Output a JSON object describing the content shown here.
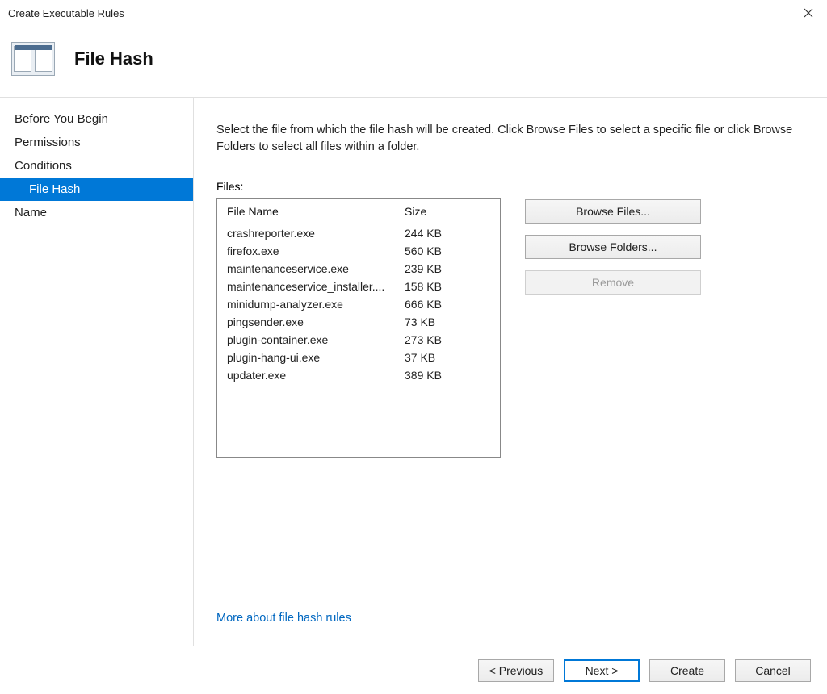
{
  "window": {
    "title": "Create Executable Rules"
  },
  "header": {
    "title": "File Hash"
  },
  "sidebar": {
    "items": [
      {
        "label": "Before You Begin",
        "selected": false,
        "sub": false
      },
      {
        "label": "Permissions",
        "selected": false,
        "sub": false
      },
      {
        "label": "Conditions",
        "selected": false,
        "sub": false
      },
      {
        "label": "File Hash",
        "selected": true,
        "sub": true
      },
      {
        "label": "Name",
        "selected": false,
        "sub": false
      }
    ]
  },
  "main": {
    "instructions": "Select the file from which the file hash will be created. Click Browse Files to select a specific file or click Browse Folders to select all files within a folder.",
    "files_label": "Files:",
    "columns": {
      "name": "File Name",
      "size": "Size"
    },
    "files": [
      {
        "name": "crashreporter.exe",
        "size": "244 KB"
      },
      {
        "name": "firefox.exe",
        "size": "560 KB"
      },
      {
        "name": "maintenanceservice.exe",
        "size": "239 KB"
      },
      {
        "name": "maintenanceservice_installer....",
        "size": "158 KB"
      },
      {
        "name": "minidump-analyzer.exe",
        "size": "666 KB"
      },
      {
        "name": "pingsender.exe",
        "size": "73 KB"
      },
      {
        "name": "plugin-container.exe",
        "size": "273 KB"
      },
      {
        "name": "plugin-hang-ui.exe",
        "size": "37 KB"
      },
      {
        "name": "updater.exe",
        "size": "389 KB"
      }
    ],
    "buttons": {
      "browse_files": "Browse Files...",
      "browse_folders": "Browse Folders...",
      "remove": "Remove"
    },
    "more_link": "More about file hash rules"
  },
  "footer": {
    "previous": "< Previous",
    "next": "Next >",
    "create": "Create",
    "cancel": "Cancel"
  }
}
